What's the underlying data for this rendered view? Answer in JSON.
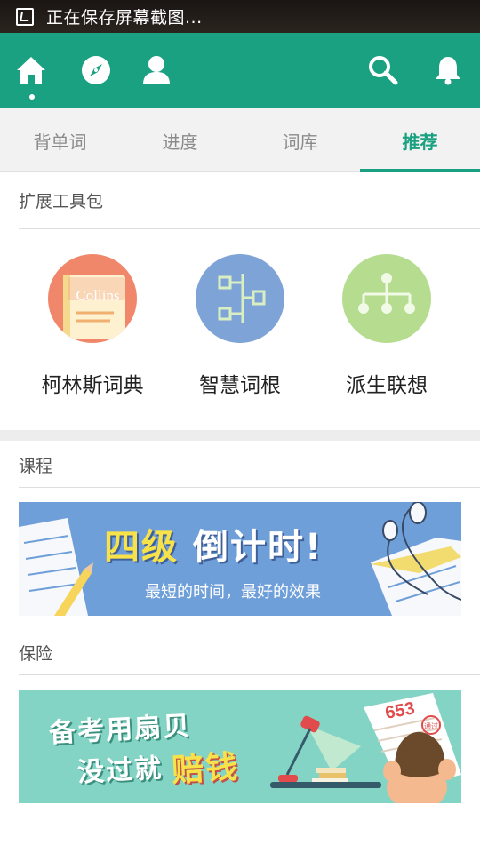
{
  "status_bar": {
    "text": "正在保存屏幕截图..."
  },
  "app_bar": {
    "icons": [
      "home-icon",
      "compass-icon",
      "profile-icon",
      "search-icon",
      "bell-icon"
    ]
  },
  "tabs": [
    {
      "label": "背单词",
      "active": false
    },
    {
      "label": "进度",
      "active": false
    },
    {
      "label": "词库",
      "active": false
    },
    {
      "label": "推荐",
      "active": true
    }
  ],
  "sections": {
    "tools": {
      "title": "扩展工具包",
      "items": [
        {
          "label": "柯林斯词典",
          "icon": "collins-book-icon",
          "book_text": "Collins",
          "color": "#f0876a"
        },
        {
          "label": "智慧词根",
          "icon": "word-root-tree-icon",
          "color": "#7ea3d6"
        },
        {
          "label": "派生联想",
          "icon": "derivation-tree-icon",
          "color": "#b5dc8f"
        }
      ]
    },
    "course": {
      "title": "课程",
      "banner": {
        "headline_a": "四级",
        "headline_b": "倒计时!",
        "subline": "最短的时间，最好的效果",
        "bg_color": "#6f9fd8"
      }
    },
    "insurance": {
      "title": "保险",
      "banner": {
        "line1": "备考用扇贝",
        "line2_a": "没过就",
        "line2_b": "赔钱",
        "score": "653",
        "stamp": "通过",
        "bg_color": "#83d4c4"
      }
    }
  },
  "colors": {
    "primary": "#1aa181",
    "tab_inactive": "#8a8a8a"
  }
}
